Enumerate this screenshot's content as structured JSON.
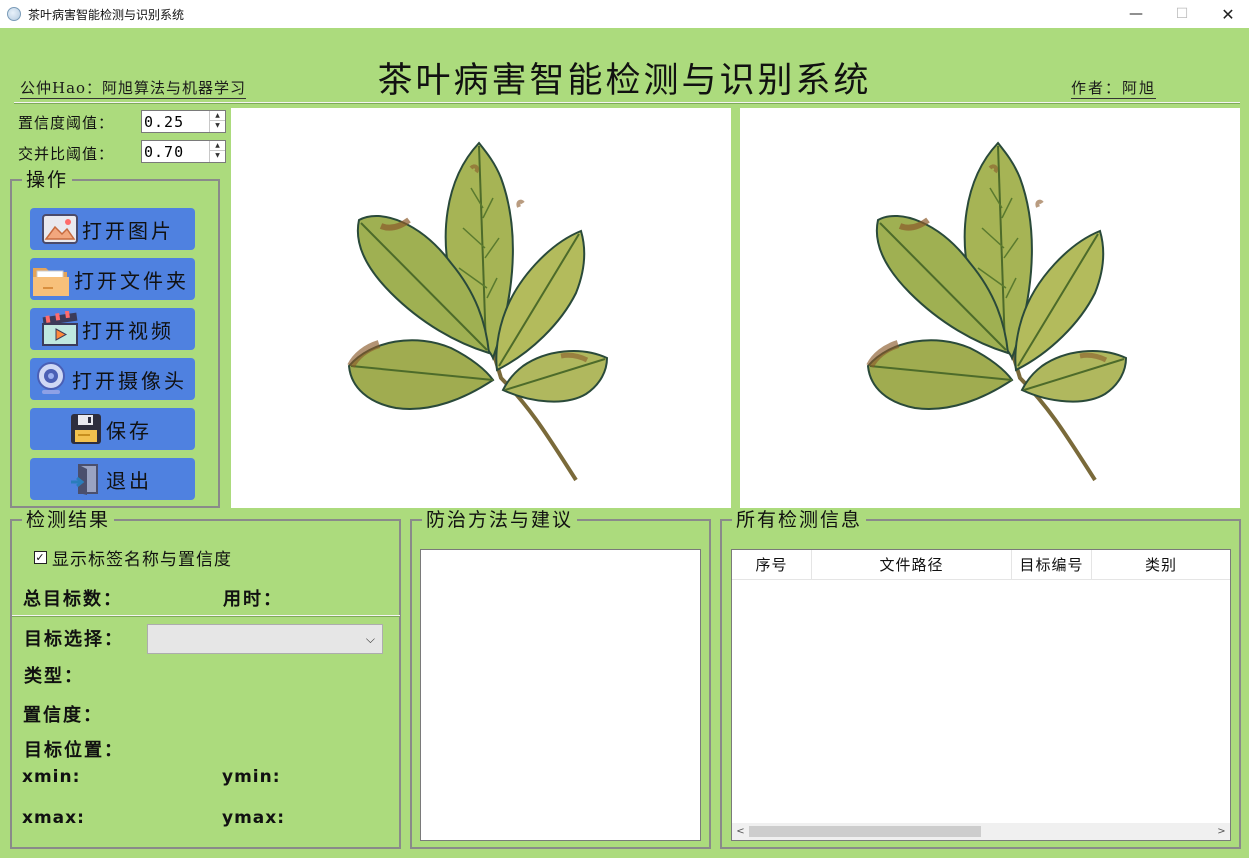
{
  "window": {
    "title": "茶叶病害智能检测与识别系统",
    "minimize": "—",
    "maximize": "☐",
    "close": "✕"
  },
  "header": {
    "title": "茶叶病害智能检测与识别系统",
    "public": "公仲Hao：阿旭算法与机器学习",
    "author": "作者：阿旭"
  },
  "params": {
    "conf_label": "置信度阈值：",
    "conf_value": "0.25",
    "iou_label": "交并比阈值：",
    "iou_value": "0.70"
  },
  "operations": {
    "title": "操作",
    "buttons": [
      {
        "label": "打开图片",
        "icon": "image-icon"
      },
      {
        "label": "打开文件夹",
        "icon": "folder-icon"
      },
      {
        "label": "打开视频",
        "icon": "video-icon"
      },
      {
        "label": "打开摄像头",
        "icon": "webcam-icon"
      },
      {
        "label": "保存",
        "icon": "save-icon"
      },
      {
        "label": "退出",
        "icon": "exit-icon"
      }
    ]
  },
  "results": {
    "title": "检测结果",
    "show_labels": "显示标签名称与置信度",
    "total_label": "总目标数：",
    "time_label": "用时：",
    "target_select_label": "目标选择：",
    "type_label": "类型：",
    "confidence_label": "置信度：",
    "position_label": "目标位置：",
    "xmin_label": "xmin:",
    "ymin_label": "ymin:",
    "xmax_label": "xmax:",
    "ymax_label": "ymax:"
  },
  "advice": {
    "title": "防治方法与建议"
  },
  "info": {
    "title": "所有检测信息",
    "columns": [
      "序号",
      "文件路径",
      "目标编号",
      "类别"
    ]
  },
  "colors": {
    "background": "#acdb7d",
    "button": "#4f81e0",
    "leaf_light": "#b3bb5c",
    "leaf_dark": "#5f7a2c",
    "leaf_disease": "#8b5a2b"
  }
}
